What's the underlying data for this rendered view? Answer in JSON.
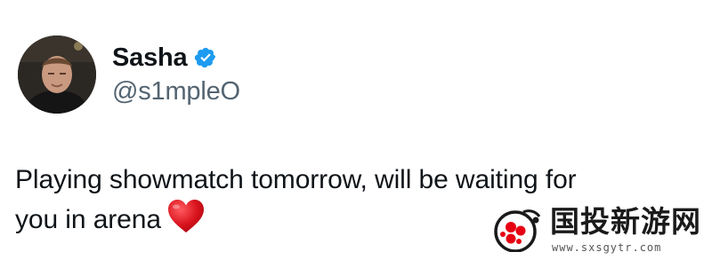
{
  "author": {
    "display_name": "Sasha",
    "handle": "@s1mpleO",
    "verified": true,
    "verified_color": "#1d9bf0",
    "avatar_icon": "profile-photo"
  },
  "tweet": {
    "lines": [
      "Playing showmatch tomorrow, will be waiting for",
      "you in arena"
    ],
    "emoji": "heart-icon",
    "emoji_color": "#d0121a"
  },
  "watermark": {
    "title": "国投新游网",
    "url": "www.sxsgytr.com",
    "accent_color": "#e60012"
  }
}
